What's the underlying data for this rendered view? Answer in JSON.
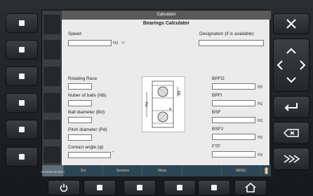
{
  "window_title": "Calculator",
  "heading": "Bearings Calculator",
  "fields": {
    "speed_label": "Speed",
    "speed_unit": "Hz",
    "designation_label": "Designation (if is available)",
    "rotating_race_label": "Rotating Race",
    "num_balls_label": "Nuber of balls (Nb)",
    "ball_diameter_label": "Ball diameter (Bd)",
    "pitch_diameter_label": "Pitch diameter (Pd)",
    "contact_angle_label": "Contact angle (φ)",
    "contact_angle_unit": "°"
  },
  "results": {
    "bpfo_label": "BPFO",
    "bpfi_label": "BPFI",
    "bsf_label": "BSF",
    "bsf2_label": "BSF2",
    "ftf_label": "FTF",
    "unit": "Hz"
  },
  "diagram": {
    "bd_label": "Bd",
    "pd_label": "Pd",
    "phi_label": "φ"
  },
  "bottom_bar": {
    "time": "14:26",
    "date": "30.04.2015",
    "tabs": [
      "Set",
      "Sensors",
      "Meas",
      "",
      "MENU"
    ]
  },
  "colors": {
    "accent_tab_text": "#f0c890",
    "bottom_bar": "#2c4653"
  },
  "icons": {
    "close": "close-icon",
    "up": "arrow-up-icon",
    "left": "arrow-left-icon",
    "right": "arrow-right-icon",
    "down": "arrow-down-icon",
    "enter": "enter-icon",
    "backspace": "backspace-icon",
    "fast_forward": "fast-forward-icon",
    "power": "power-icon",
    "home": "home-icon",
    "battery": "battery-icon"
  }
}
